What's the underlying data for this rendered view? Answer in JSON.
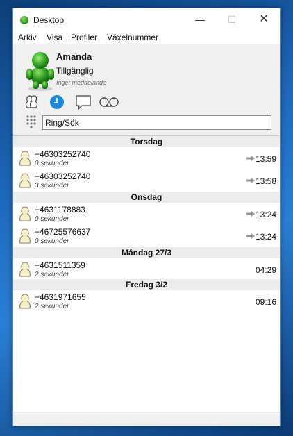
{
  "window": {
    "title": "Desktop"
  },
  "menu": [
    "Arkiv",
    "Visa",
    "Profiler",
    "Växelnummer"
  ],
  "profile": {
    "name": "Amanda",
    "status": "Tillgänglig",
    "message": "Inget meddelande"
  },
  "toolbar": [
    "contacts-icon",
    "history-icon",
    "chat-icon",
    "voicemail-icon"
  ],
  "search": {
    "placeholder": "Ring/Sök"
  },
  "groups": [
    {
      "day": "Torsdag",
      "calls": [
        {
          "number": "+46303252740",
          "duration": "0 sekunder",
          "time": "13:59",
          "forwarded": true
        },
        {
          "number": "+46303252740",
          "duration": "3 sekunder",
          "time": "13:58",
          "forwarded": true
        }
      ]
    },
    {
      "day": "Onsdag",
      "calls": [
        {
          "number": "+4631178883",
          "duration": "0 sekunder",
          "time": "13:24",
          "forwarded": true
        },
        {
          "number": "+46725576637",
          "duration": "0 sekunder",
          "time": "13:24",
          "forwarded": true
        }
      ]
    },
    {
      "day": "Måndag 27/3",
      "calls": [
        {
          "number": "+4631511359",
          "duration": "2 sekunder",
          "time": "04:29",
          "forwarded": false
        }
      ]
    },
    {
      "day": "Fredag 3/2",
      "calls": [
        {
          "number": "+4631971655",
          "duration": "2 sekunder",
          "time": "09:16",
          "forwarded": false
        }
      ]
    }
  ],
  "colors": {
    "accent": "#1e88d6",
    "avatar_green": "#2c9a1f",
    "header_bg": "#ececec"
  }
}
